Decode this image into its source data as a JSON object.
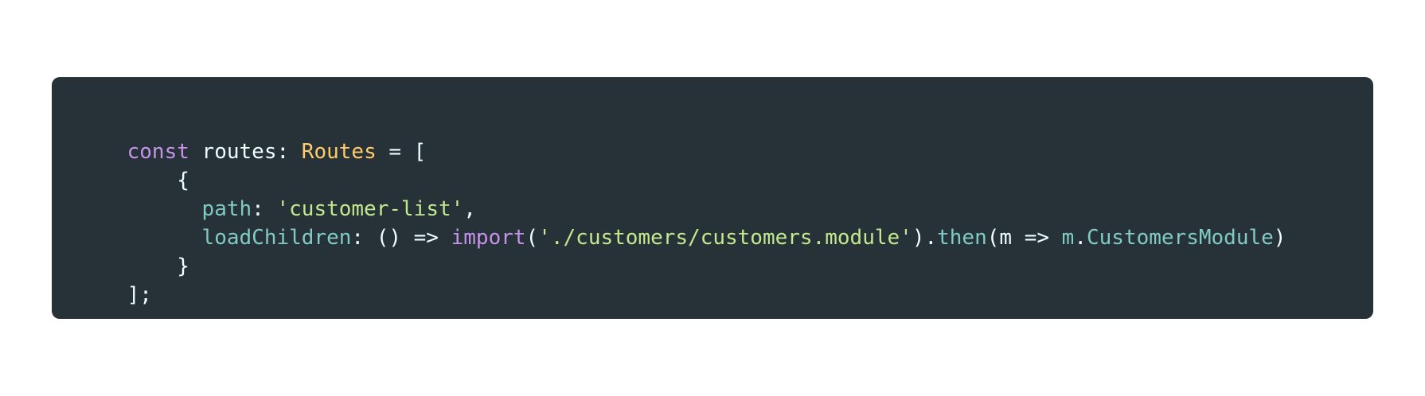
{
  "code": {
    "lines": [
      {
        "tokens": [
          {
            "text": "const",
            "kind": "keyword"
          },
          {
            "text": " routes: ",
            "kind": "ident"
          },
          {
            "text": "Routes",
            "kind": "type"
          },
          {
            "text": " = [",
            "kind": "punct"
          }
        ]
      },
      {
        "tokens": [
          {
            "text": "    {",
            "kind": "punct"
          }
        ]
      },
      {
        "tokens": [
          {
            "text": "      ",
            "kind": "punct"
          },
          {
            "text": "path",
            "kind": "prop"
          },
          {
            "text": ": ",
            "kind": "punct"
          },
          {
            "text": "'customer-list'",
            "kind": "string"
          },
          {
            "text": ",",
            "kind": "punct"
          }
        ]
      },
      {
        "tokens": [
          {
            "text": "      ",
            "kind": "punct"
          },
          {
            "text": "loadChildren",
            "kind": "prop"
          },
          {
            "text": ": () => ",
            "kind": "punct"
          },
          {
            "text": "import",
            "kind": "keyword"
          },
          {
            "text": "(",
            "kind": "punct"
          },
          {
            "text": "'./customers/customers.module'",
            "kind": "string"
          },
          {
            "text": ").",
            "kind": "punct"
          },
          {
            "text": "then",
            "kind": "prop"
          },
          {
            "text": "(m => ",
            "kind": "punct"
          },
          {
            "text": "m",
            "kind": "prop"
          },
          {
            "text": ".",
            "kind": "punct"
          },
          {
            "text": "CustomersModule",
            "kind": "prop"
          },
          {
            "text": ")",
            "kind": "punct"
          }
        ]
      },
      {
        "tokens": [
          {
            "text": "    }",
            "kind": "punct"
          }
        ]
      },
      {
        "tokens": [
          {
            "text": "];",
            "kind": "punct"
          }
        ]
      }
    ]
  },
  "colors": {
    "background": "#263238",
    "keyword": "#c792ea",
    "type": "#ffcb6b",
    "property": "#80cbc4",
    "string": "#c3e88d",
    "text": "#eeffff"
  }
}
